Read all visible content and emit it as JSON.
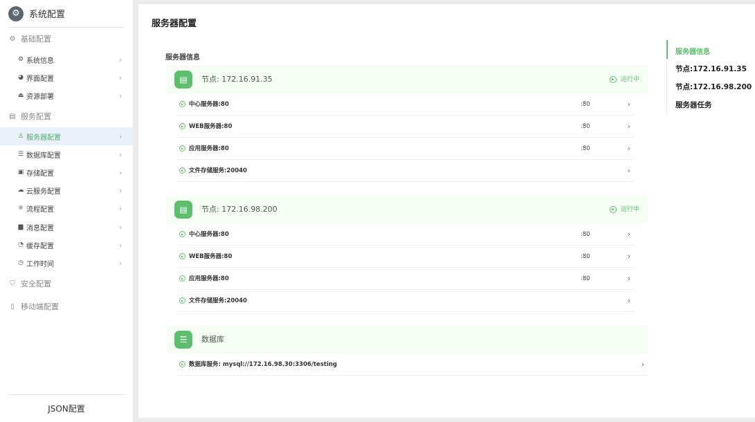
{
  "sidebar": {
    "title": "系统配置",
    "logo_icon": "gear-icon",
    "groups": [
      {
        "label": "基础配置",
        "icon": "gear-icon"
      },
      {
        "label": "服务配置",
        "icon": "server-icon"
      },
      {
        "label": "安全配置",
        "icon": "shield-icon"
      },
      {
        "label": "移动端配置",
        "icon": "mobile-icon"
      }
    ],
    "items": [
      {
        "label": "系统信息",
        "icon": "gear-icon"
      },
      {
        "label": "界面配置",
        "icon": "palette-icon"
      },
      {
        "label": "资源部署",
        "icon": "deploy-icon"
      },
      {
        "label": "服务器配置",
        "icon": "user-server-icon",
        "active": true
      },
      {
        "label": "数据库配置",
        "icon": "database-icon"
      },
      {
        "label": "存储配置",
        "icon": "storage-icon"
      },
      {
        "label": "云服务配置",
        "icon": "cloud-icon"
      },
      {
        "label": "流程配置",
        "icon": "flow-icon"
      },
      {
        "label": "消息配置",
        "icon": "message-icon"
      },
      {
        "label": "缓存配置",
        "icon": "cache-icon"
      },
      {
        "label": "工作时间",
        "icon": "timer-icon"
      }
    ],
    "footer": "JSON配置"
  },
  "main": {
    "page_title": "服务器配置",
    "section_title": "服务器信息",
    "nodes": [
      {
        "label": "节点: 172.16.91.35",
        "status": "运行中",
        "rows": [
          {
            "label": "中心服务器:80",
            "port": ":80"
          },
          {
            "label": "WEB服务器:80",
            "port": ":80"
          },
          {
            "label": "应用服务器:80",
            "port": ":80"
          },
          {
            "label": "文件存储服务:20040",
            "port": ""
          }
        ]
      },
      {
        "label": "节点: 172.16.98.200",
        "status": "运行中",
        "rows": [
          {
            "label": "中心服务器:80",
            "port": ":80"
          },
          {
            "label": "WEB服务器:80",
            "port": ":80"
          },
          {
            "label": "应用服务器:80",
            "port": ":80"
          },
          {
            "label": "文件存储服务:20040",
            "port": ""
          }
        ]
      }
    ],
    "database": {
      "label": "数据库",
      "rows": [
        {
          "label": "数据库服务: mysql://172.16.98.30:3306/testing"
        }
      ]
    }
  },
  "anchor_nav": {
    "items": [
      {
        "label": "服务器信息",
        "active": true
      },
      {
        "label": "节点:172.16.91.35"
      },
      {
        "label": "节点:172.16.98.200"
      },
      {
        "label": "服务器任务"
      }
    ]
  },
  "colors": {
    "accent_green": "#5dbf6e",
    "active_bg": "#eaf0f8"
  }
}
